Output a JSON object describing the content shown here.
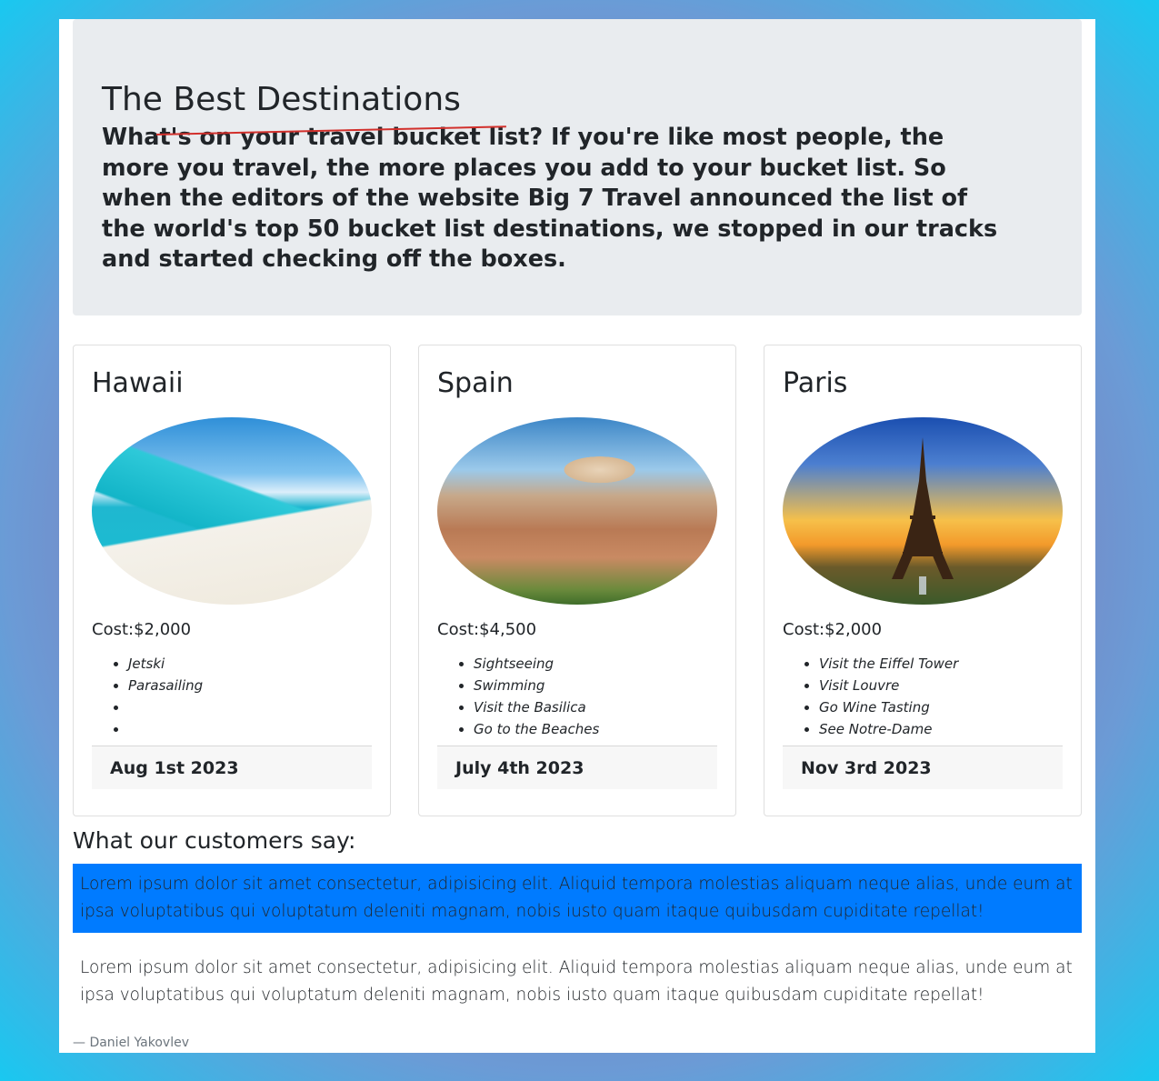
{
  "jumbotron": {
    "title": "The Best Destinations",
    "lead": "What's on your travel bucket list? If you're like most people, the more you travel, the more places you add to your bucket list. So when the editors of the website Big 7 Travel announced the list of the world's top 50 bucket list destinations, we stopped in our tracks and started checking off the boxes."
  },
  "cards": [
    {
      "title": "Hawaii",
      "image": "beach-resort-photo",
      "cost": "Cost:$2,000",
      "activities": [
        "Jetski",
        "Parasailing",
        "",
        ""
      ],
      "date": "Aug 1st 2023"
    },
    {
      "title": "Spain",
      "image": "hilltop-city-photo",
      "cost": "Cost:$4,500",
      "activities": [
        "Sightseeing",
        "Swimming",
        "Visit the Basilica",
        "Go to the Beaches"
      ],
      "date": "July 4th 2023"
    },
    {
      "title": "Paris",
      "image": "eiffel-tower-sunset-photo",
      "cost": "Cost:$2,000",
      "activities": [
        "Visit the Eiffel Tower",
        "Visit Louvre",
        "Go Wine Tasting",
        "See Notre-Dame"
      ],
      "date": "Nov 3rd 2023"
    }
  ],
  "testimonials": {
    "title": "What our customers say:",
    "quotes": [
      "Lorem ipsum dolor sit amet consectetur, adipisicing elit. Aliquid tempora molestias aliquam neque alias, unde eum at ipsa voluptatibus qui voluptatum deleniti magnam, nobis iusto quam itaque quibusdam cupiditate repellat!",
      "Lorem ipsum dolor sit amet consectetur, adipisicing elit. Aliquid tempora molestias aliquam neque alias, unde eum at ipsa voluptatibus qui voluptatum deleniti magnam, nobis iusto quam itaque quibusdam cupiditate repellat!"
    ],
    "author": "— Daniel Yakovlev"
  },
  "colors": {
    "primary": "#007bff",
    "jumbotron_bg": "#e9ecef",
    "strike": "#d2302c"
  }
}
